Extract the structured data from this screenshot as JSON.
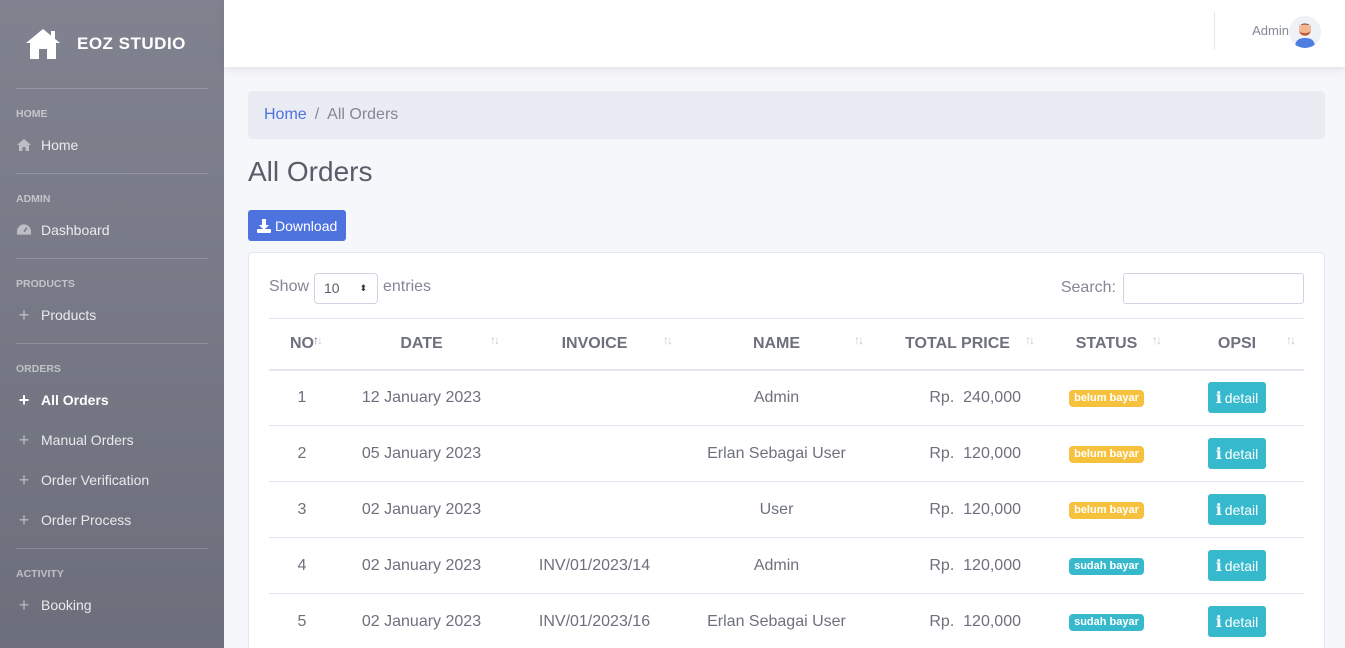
{
  "brand": {
    "name": "EOZ STUDIO",
    "icon": "home-icon"
  },
  "sidebar": {
    "sections": [
      {
        "heading": "HOME",
        "items": [
          {
            "label": "Home",
            "icon": "home-icon"
          }
        ]
      },
      {
        "heading": "ADMIN",
        "items": [
          {
            "label": "Dashboard",
            "icon": "tachometer-icon"
          }
        ]
      },
      {
        "heading": "PRODUCTS",
        "items": [
          {
            "label": "Products",
            "icon": "plus-icon"
          }
        ]
      },
      {
        "heading": "ORDERS",
        "items": [
          {
            "label": "All Orders",
            "icon": "plus-icon",
            "active": true
          },
          {
            "label": "Manual Orders",
            "icon": "plus-icon"
          },
          {
            "label": "Order Verification",
            "icon": "plus-icon"
          },
          {
            "label": "Order Process",
            "icon": "plus-icon"
          }
        ]
      },
      {
        "heading": "ACTIVITY",
        "items": [
          {
            "label": "Booking",
            "icon": "plus-icon"
          }
        ]
      }
    ]
  },
  "topbar": {
    "user_name": "Admin",
    "avatar_icon": "avatar-icon"
  },
  "breadcrumb": {
    "home": "Home",
    "separator": "/",
    "current": "All Orders"
  },
  "page": {
    "title": "All Orders",
    "download_label": "Download"
  },
  "table_controls": {
    "show_label": "Show",
    "entries_value": "10",
    "entries_label": "entries",
    "search_label": "Search:",
    "search_value": ""
  },
  "table": {
    "columns": [
      "NO",
      "DATE",
      "INVOICE",
      "NAME",
      "TOTAL PRICE",
      "STATUS",
      "OPSI"
    ],
    "rows": [
      {
        "no": "1",
        "date": "12 January 2023",
        "invoice": "",
        "name": "Admin",
        "currency": "Rp.",
        "amount": "240,000",
        "status": "belum bayar",
        "status_type": "warning",
        "action": "detail"
      },
      {
        "no": "2",
        "date": "05 January 2023",
        "invoice": "",
        "name": "Erlan Sebagai User",
        "currency": "Rp.",
        "amount": "120,000",
        "status": "belum bayar",
        "status_type": "warning",
        "action": "detail"
      },
      {
        "no": "3",
        "date": "02 January 2023",
        "invoice": "",
        "name": "User",
        "currency": "Rp.",
        "amount": "120,000",
        "status": "belum bayar",
        "status_type": "warning",
        "action": "detail"
      },
      {
        "no": "4",
        "date": "02 January 2023",
        "invoice": "INV/01/2023/14",
        "name": "Admin",
        "currency": "Rp.",
        "amount": "120,000",
        "status": "sudah bayar",
        "status_type": "info",
        "action": "detail"
      },
      {
        "no": "5",
        "date": "02 January 2023",
        "invoice": "INV/01/2023/16",
        "name": "Erlan Sebagai User",
        "currency": "Rp.",
        "amount": "120,000",
        "status": "sudah bayar",
        "status_type": "info",
        "action": "detail"
      }
    ]
  },
  "colors": {
    "primary": "#4e73df",
    "info": "#36b9cc",
    "warning": "#f6c23e",
    "sidebar": "#76798a"
  }
}
